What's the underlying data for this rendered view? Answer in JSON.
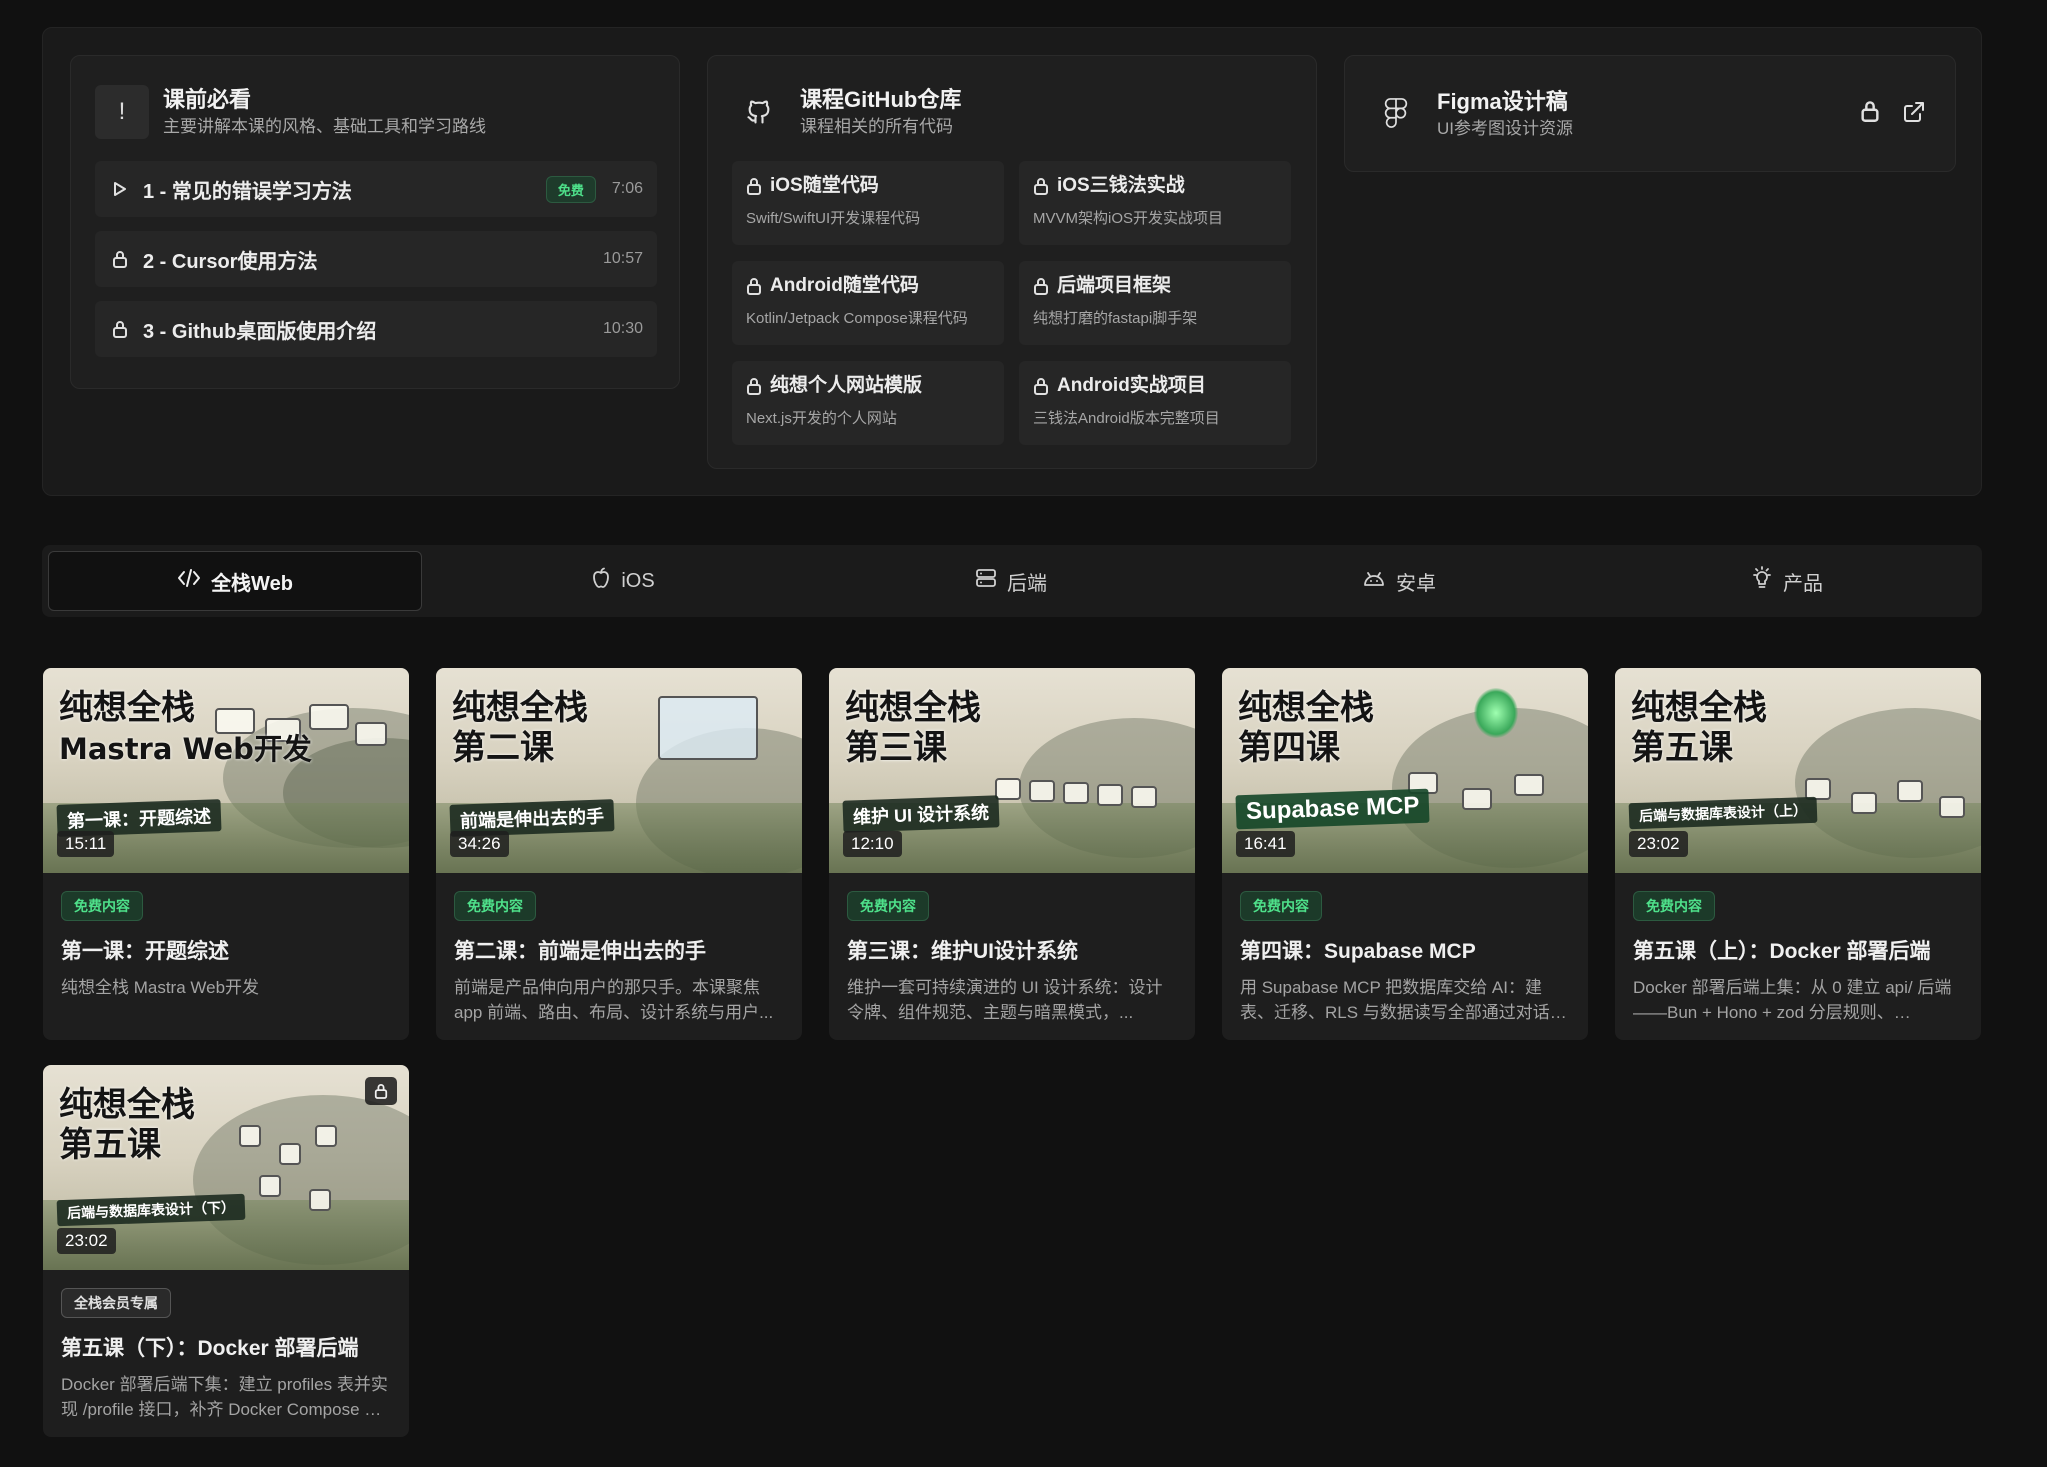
{
  "prereq": {
    "icon": "exclamation-icon",
    "title": "课前必看",
    "subtitle": "主要讲解本课的风格、基础工具和学习路线",
    "lessons": [
      {
        "label": "1 - 常见的错误学习方法",
        "tag": "免费",
        "duration": "7:06",
        "icon": "play-icon"
      },
      {
        "label": "2 - Cursor使用方法",
        "tag": "",
        "duration": "10:57",
        "icon": "lock-icon"
      },
      {
        "label": "3 - Github桌面版使用介绍",
        "tag": "",
        "duration": "10:30",
        "icon": "lock-icon"
      }
    ]
  },
  "github": {
    "icon": "github-icon",
    "title": "课程GitHub仓库",
    "subtitle": "课程相关的所有代码",
    "repos": [
      {
        "title": "iOS随堂代码",
        "desc": "Swift/SwiftUI开发课程代码"
      },
      {
        "title": "iOS三钱法实战",
        "desc": "MVVM架构iOS开发实战项目"
      },
      {
        "title": "Android随堂代码",
        "desc": "Kotlin/Jetpack Compose课程代码"
      },
      {
        "title": "后端项目框架",
        "desc": "纯想打磨的fastapi脚手架"
      },
      {
        "title": "纯想个人网站模版",
        "desc": "Next.js开发的个人网站"
      },
      {
        "title": "Android实战项目",
        "desc": "三钱法Android版本完整项目"
      }
    ]
  },
  "figma": {
    "icon": "figma-icon",
    "title": "Figma设计稿",
    "subtitle": "UI参考图设计资源"
  },
  "tabs": [
    {
      "label": "全栈Web",
      "icon": "code-icon",
      "active": true
    },
    {
      "label": "iOS",
      "icon": "apple-icon",
      "active": false
    },
    {
      "label": "后端",
      "icon": "server-icon",
      "active": false
    },
    {
      "label": "安卓",
      "icon": "android-icon",
      "active": false
    },
    {
      "label": "产品",
      "icon": "lightbulb-icon",
      "active": false
    }
  ],
  "videos": [
    {
      "thumb": {
        "line1": "纯想全栈",
        "line2": "Mastra Web开发",
        "ribbon": "第一课：开题综述",
        "duration": "15:11"
      },
      "badge": "免费内容",
      "badge_type": "free",
      "title": "第一课：开题综述",
      "desc": "纯想全栈 Mastra Web开发"
    },
    {
      "thumb": {
        "line1": "纯想全栈",
        "line2": "第二课",
        "ribbon": "前端是伸出去的手",
        "duration": "34:26"
      },
      "badge": "免费内容",
      "badge_type": "free",
      "title": "第二课：前端是伸出去的手",
      "desc": "前端是产品伸向用户的那只手。本课聚焦 app 前端、路由、布局、设计系统与用户..."
    },
    {
      "thumb": {
        "line1": "纯想全栈",
        "line2": "第三课",
        "ribbon": "维护 UI 设计系统",
        "duration": "12:10"
      },
      "badge": "免费内容",
      "badge_type": "free",
      "title": "第三课：维护UI设计系统",
      "desc": "维护一套可持续演进的 UI 设计系统：设计令牌、组件规范、主题与暗黑模式，..."
    },
    {
      "thumb": {
        "line1": "纯想全栈",
        "line2": "第四课",
        "ribbon": "Supabase MCP",
        "duration": "16:41"
      },
      "badge": "免费内容",
      "badge_type": "free",
      "title": "第四课：Supabase MCP",
      "desc": "用 Supabase MCP 把数据库交给 AI：建表、迁移、RLS 与数据读写全部通过对话完..."
    },
    {
      "thumb": {
        "line1": "纯想全栈",
        "line2": "第五课",
        "ribbon": "后端与数据库表设计（上）",
        "duration": "23:02"
      },
      "badge": "免费内容",
      "badge_type": "free",
      "title": "第五课（上）：Docker 部署后端",
      "desc": "Docker 部署后端上集：从 0 建立 api/ 后端 ——Bun + Hono + zod 分层规则、Supabase RES..."
    },
    {
      "thumb": {
        "line1": "纯想全栈",
        "line2": "第五课",
        "ribbon": "后端与数据库表设计（下）",
        "duration": "23:02"
      },
      "badge": "全栈会员专属",
      "badge_type": "member",
      "title": "第五课（下）：Docker 部署后端",
      "desc": "Docker 部署后端下集：建立 profiles 表并实现 /profile 接口，补齐 Docker Compose 本地..."
    }
  ]
}
